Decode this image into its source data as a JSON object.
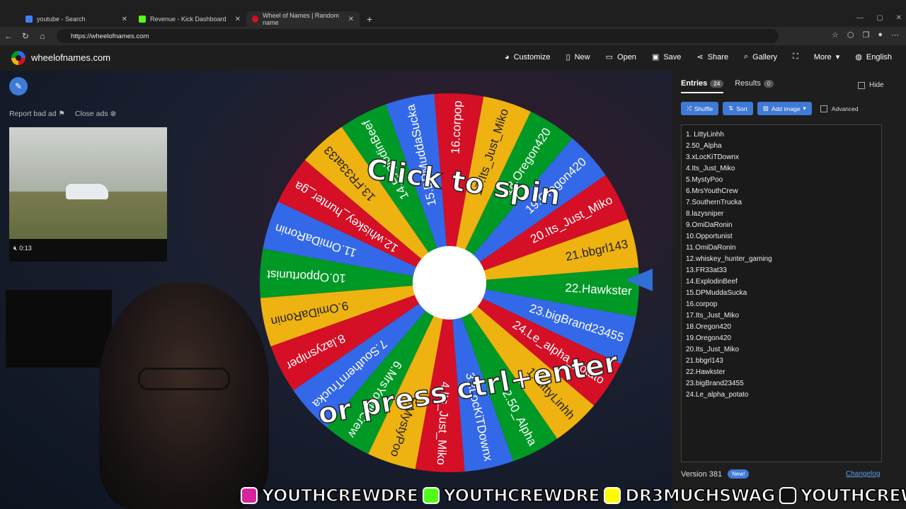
{
  "browser": {
    "tabs": [
      {
        "title": "youtube - Search",
        "color": "#3b82f6",
        "active": false
      },
      {
        "title": "Revenue - Kick Dashboard",
        "color": "#53fc18",
        "active": false
      },
      {
        "title": "Wheel of Names | Random name",
        "color": "#d50f25",
        "active": true
      }
    ],
    "url": "https://wheelofnames.com"
  },
  "site": {
    "name": "wheelofnames.com",
    "menu": [
      {
        "label": "Customize",
        "icon": "palette-icon"
      },
      {
        "label": "New",
        "icon": "new-file-icon"
      },
      {
        "label": "Open",
        "icon": "folder-icon"
      },
      {
        "label": "Save",
        "icon": "save-icon"
      },
      {
        "label": "Share",
        "icon": "share-icon"
      },
      {
        "label": "Gallery",
        "icon": "search-icon"
      },
      {
        "label": "",
        "icon": "fullscreen-icon"
      },
      {
        "label": "More",
        "icon": "chevron-down-icon"
      },
      {
        "label": "English",
        "icon": "globe-icon"
      }
    ]
  },
  "ad": {
    "report": "Report bad ad",
    "close": "Close ads",
    "time": "0:13"
  },
  "wheel": {
    "hint_top": "Click to spin",
    "hint_bottom": "or press ctrl+enter",
    "colors": [
      "#eeb211",
      "#d50f25",
      "#3369e8",
      "#009925"
    ],
    "labels": [
      "21.bbgrl143",
      "20.Its_Just_Miko",
      "19.Oregon420",
      "18.Oregon420",
      "17.Its_Just_Miko",
      "16.corpop",
      "15.DPMuddaSucka",
      "14.ExplodinBeef",
      "13.FR33at33",
      "12.whiskey_hunter_gaming",
      "11.OmiDaRonin",
      "10.Opportunist",
      "9.OmiDaRonin",
      "8.lazysniper",
      "7.SouthernTrucka",
      "6.MrsYouthCrew",
      "5.MystyPoo",
      "4.Its_Just_Miko",
      "3.xLocKiTDownx",
      "2.50_Alpha",
      "1. LittyLinhh",
      "24.Le_alpha_potato",
      "23.bigBrand23455",
      "22.Hawkster"
    ]
  },
  "panel": {
    "tab_entries": "Entries",
    "entries_count": "24",
    "tab_results": "Results",
    "results_count": "0",
    "hide": "Hide",
    "shuffle": "Shuffle",
    "sort": "Sort",
    "add_image": "Add image",
    "advanced": "Advanced",
    "entries": [
      "1. LittyLinhh",
      "2.50_Alpha",
      "3.xLocKiTDownx",
      "4.Its_Just_Miko",
      "5.MystyPoo",
      "6.MrsYouthCrew",
      "7.SouthernTrucka",
      "8.lazysniper",
      "9.OmiDaRonin",
      "10.Opportunist",
      "11.OmiDaRonin",
      "12.whiskey_hunter_gaming",
      "13.FR33at33",
      "14.ExplodinBeef",
      "15.DPMuddaSucka",
      "16.corpop",
      "17.Its_Just_Miko",
      "18.Oregon420",
      "19.Oregon420",
      "20.Its_Just_Miko",
      "21.bbgrl143",
      "22.Hawkster",
      "23.bigBrand23455",
      "24.Le_alpha_potato"
    ],
    "version": "Version 381",
    "new_badge": "New!",
    "changelog": "Changelog"
  },
  "overlay": {
    "socials": [
      {
        "icon": "instagram-icon",
        "handle": "YOUTHCREWDRE",
        "color": "#d6249f"
      },
      {
        "icon": "kick-icon",
        "handle": "YOUTHCREWDRE",
        "color": "#53fc18"
      },
      {
        "icon": "snapchat-icon",
        "handle": "DR3MUCHSWAG",
        "color": "#fffc00"
      },
      {
        "icon": "tiktok-icon",
        "handle": "YOUTHCREWDRE",
        "color": "#111111"
      }
    ]
  }
}
